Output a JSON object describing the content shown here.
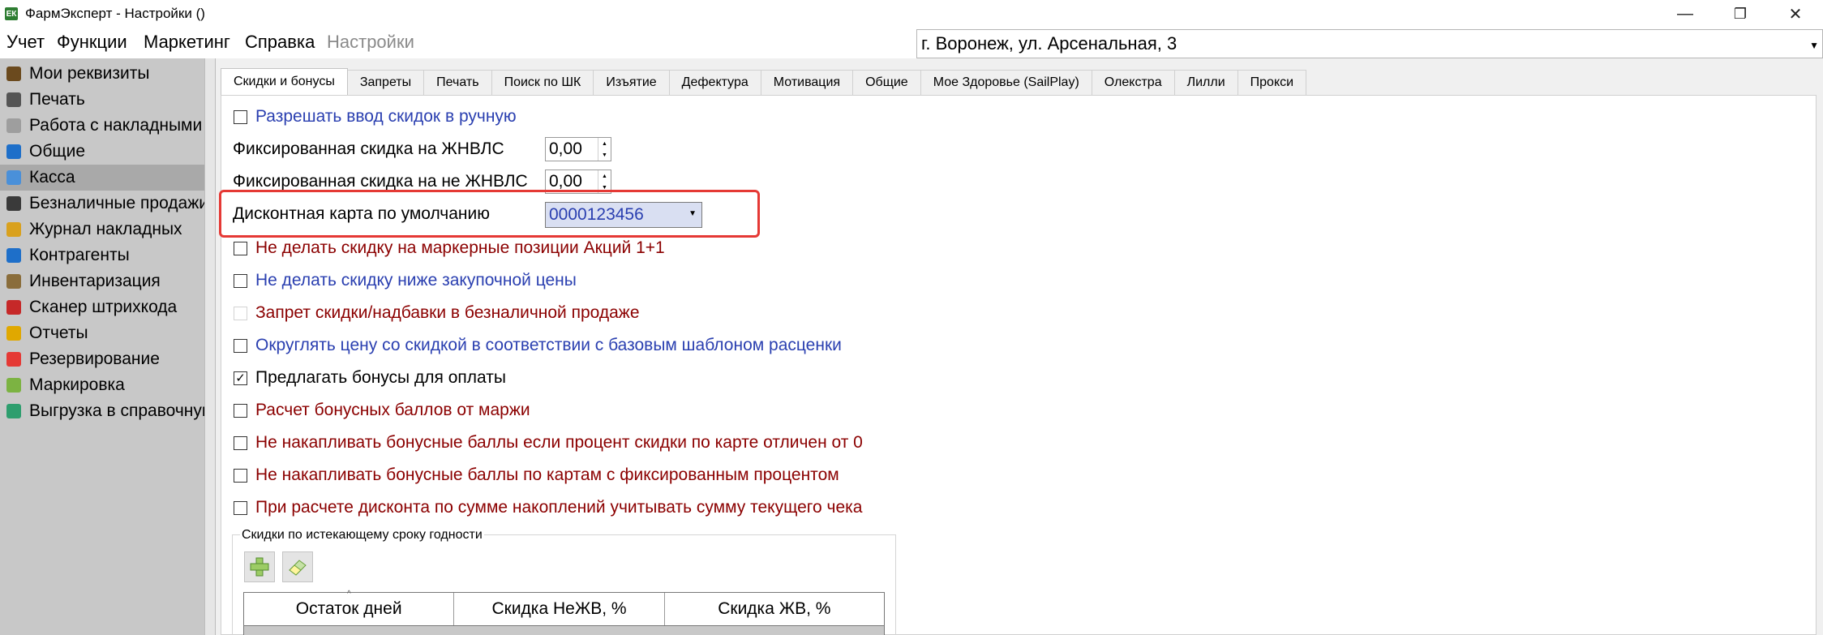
{
  "window": {
    "title": "ФармЭксперт - Настройки ()",
    "icon_text": "ЕК",
    "minimize_glyph": "—",
    "restore_glyph": "❐",
    "close_glyph": "✕"
  },
  "menubar": {
    "items": [
      "Учет",
      "Функции",
      "Маркетинг",
      "Справка",
      "Настройки"
    ],
    "address": "г. Воронеж, ул. Арсенальная, 3"
  },
  "sidebar": {
    "selected_index": 4,
    "items": [
      {
        "label": "Мои реквизиты",
        "icon": "rubber-stamp-icon",
        "color": "#6b4a1e"
      },
      {
        "label": "Печать",
        "icon": "printer-icon",
        "color": "#555555"
      },
      {
        "label": "Работа с накладными",
        "icon": "document-icon",
        "color": "#9e9e9e"
      },
      {
        "label": "Общие",
        "icon": "book-icon",
        "color": "#1e6fc9"
      },
      {
        "label": "Касса",
        "icon": "cash-register-icon",
        "color": "#4a90d9"
      },
      {
        "label": "Безналичные продажи",
        "icon": "card-terminal-icon",
        "color": "#3a3a3a"
      },
      {
        "label": "Журнал накладных",
        "icon": "journal-icon",
        "color": "#d9a11e"
      },
      {
        "label": "Контрагенты",
        "icon": "contacts-icon",
        "color": "#1e6fc9"
      },
      {
        "label": "Инвентаризация",
        "icon": "inventory-boxes-icon",
        "color": "#8a6d3b"
      },
      {
        "label": "Сканер штрихкода",
        "icon": "barcode-icon",
        "color": "#c62828"
      },
      {
        "label": "Отчеты",
        "icon": "reports-icon",
        "color": "#e0a800"
      },
      {
        "label": "Резервирование",
        "icon": "reservation-icon",
        "color": "#e53935"
      },
      {
        "label": "Маркировка",
        "icon": "marking-icon",
        "color": "#7cb342"
      },
      {
        "label": "Выгрузка в справочную",
        "icon": "upload-globe-icon",
        "color": "#2e9e6e"
      }
    ]
  },
  "tabs": [
    {
      "label": "Скидки и бонусы",
      "active": true
    },
    {
      "label": "Запреты"
    },
    {
      "label": "Печать"
    },
    {
      "label": "Поиск по ШК"
    },
    {
      "label": "Изъятие"
    },
    {
      "label": "Дефектура"
    },
    {
      "label": "Мотивация"
    },
    {
      "label": "Общие"
    },
    {
      "label": "Мое Здоровье (SailPlay)"
    },
    {
      "label": "Олекстра"
    },
    {
      "label": "Лилли"
    },
    {
      "label": "Прокси"
    }
  ],
  "settings": {
    "manual_discount": {
      "label": "Разрешать ввод скидок в ручную",
      "checked": false
    },
    "fixed_zhnvls": {
      "label": "Фиксированная скидка на ЖНВЛС",
      "value": "0,00"
    },
    "fixed_non_zhnvls": {
      "label": "Фиксированная скидка на не ЖНВЛС",
      "value": "0,00"
    },
    "default_card": {
      "label": "Дисконтная карта по умолчанию",
      "value": "0000123456"
    },
    "checkboxes": [
      {
        "label": "Не делать скидку на маркерные позиции Акций 1+1",
        "checked": false,
        "enabled": true,
        "color": "red"
      },
      {
        "label": "Не делать скидку ниже закупочной цены",
        "checked": false,
        "enabled": true,
        "color": "blue"
      },
      {
        "label": "Запрет скидки/надбавки в безналичной продаже",
        "checked": false,
        "enabled": false,
        "color": "red"
      },
      {
        "label": "Округлять цену со скидкой в соответствии с базовым шаблоном расценки",
        "checked": false,
        "enabled": true,
        "color": "blue"
      },
      {
        "label": "Предлагать бонусы для оплаты",
        "checked": true,
        "enabled": true,
        "color": "black"
      },
      {
        "label": "Расчет бонусных баллов от маржи",
        "checked": false,
        "enabled": true,
        "color": "red"
      },
      {
        "label": "Не накапливать бонусные баллы если процент скидки по карте отличен от 0",
        "checked": false,
        "enabled": true,
        "color": "red"
      },
      {
        "label": "Не накапливать бонусные баллы по картам с фиксированным процентом",
        "checked": false,
        "enabled": true,
        "color": "red"
      },
      {
        "label": "При расчете дисконта по сумме накоплений учитывать сумму текущего чека",
        "checked": false,
        "enabled": true,
        "color": "red"
      }
    ]
  },
  "expiry_group": {
    "title": "Скидки по истекающему сроку годности",
    "columns": [
      "Остаток дней",
      "Скидка НеЖВ, %",
      "Скидка ЖВ, %"
    ]
  },
  "colors": {
    "blue_label": "#2a3fb0",
    "red_label": "#8b0000",
    "highlight": "#e53935",
    "sidebar_bg": "#c8c8c8",
    "selected_item_bg": "#a9a9a9"
  }
}
